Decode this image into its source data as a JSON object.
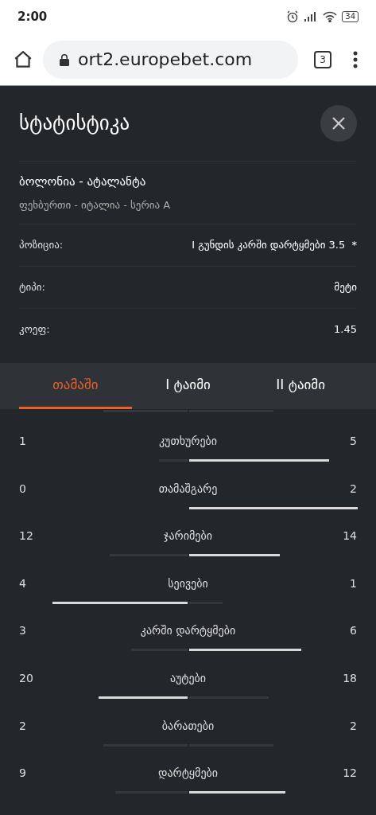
{
  "status_bar": {
    "time": "2:00",
    "battery": "34"
  },
  "browser": {
    "url": "ort2.europebet.com",
    "tab_count": "3"
  },
  "panel": {
    "title": "სტატისტიკა"
  },
  "match": {
    "teams": "ბოლონია - ატალანტა",
    "league": "ფეხბურთი - იტალია - სერია A"
  },
  "details": [
    {
      "label": "პოზიცია:",
      "value": "I გუნდის კარში დარტყმები 3.5  *"
    },
    {
      "label": "ტიპი:",
      "value": "მეტი"
    },
    {
      "label": "კოეფ:",
      "value": "1.45"
    }
  ],
  "tabs": [
    {
      "label": "თამაში",
      "selected": true
    },
    {
      "label": "I ტაიმი",
      "selected": false
    },
    {
      "label": "II ტაიმი",
      "selected": false
    }
  ],
  "stats": [
    {
      "home": "1",
      "label": "კუთხურები",
      "away": "5"
    },
    {
      "home": "0",
      "label": "თამაშგარე",
      "away": "2"
    },
    {
      "home": "12",
      "label": "ჯარიმები",
      "away": "14"
    },
    {
      "home": "4",
      "label": "სეივები",
      "away": "1"
    },
    {
      "home": "3",
      "label": "კარში დარტყმები",
      "away": "6"
    },
    {
      "home": "20",
      "label": "აუტები",
      "away": "18"
    },
    {
      "home": "2",
      "label": "ბარათები",
      "away": "2"
    },
    {
      "home": "9",
      "label": "დარტყმები",
      "away": "12"
    }
  ]
}
